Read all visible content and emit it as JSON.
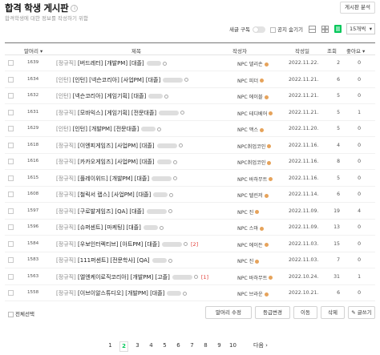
{
  "page": {
    "title": "합격 학생 게시판",
    "badge": "i",
    "subtitle": "합격학생에 대한 정보를 작성하기 위함",
    "analyze_button": "게시판 분석"
  },
  "toolbar": {
    "subscribe_label": "새글 구독",
    "hide_notice_label": "공지 숨기기",
    "per_page": "15개씩",
    "views": [
      "card-view-icon",
      "album-view-icon",
      "list-view-icon"
    ],
    "active_view": "list-view-icon",
    "accent_color": "#03c75a"
  },
  "table": {
    "headers": {
      "prefix": "말머리 ▾",
      "subject": "제목",
      "author": "작성자",
      "date": "작성일",
      "views": "조회",
      "likes": "좋아요 ▾"
    },
    "rows": [
      {
        "num": "1639",
        "head": "[정규직]",
        "title": "[버드레터] [개발PM] [대졸]",
        "author": "NPC 델리손",
        "date": "2022.11.22.",
        "views": "2",
        "likes": "0",
        "count": ""
      },
      {
        "num": "1634",
        "head": "[인턴]",
        "title": "[인턴] [넥슨코리아] [사업PM] [대졸]",
        "author": "NPC 피더",
        "date": "2022.11.21.",
        "views": "6",
        "likes": "0",
        "count": ""
      },
      {
        "num": "1632",
        "head": "[인턴]",
        "title": "[넥슨코리아] [게임기획] [대졸]",
        "author": "NPC 에이블",
        "date": "2022.11.21.",
        "views": "5",
        "likes": "0",
        "count": ""
      },
      {
        "num": "1631",
        "head": "[정규직]",
        "title": "[모바익스] [게임기획] [전문대졸]",
        "author": "NPC 테디베어",
        "date": "2022.11.21.",
        "views": "5",
        "likes": "1",
        "count": ""
      },
      {
        "num": "1629",
        "head": "[인턴]",
        "title": "[인턴] [개발PM] [전문대졸]",
        "author": "NPC 맥스",
        "date": "2022.11.20.",
        "views": "5",
        "likes": "0",
        "count": ""
      },
      {
        "num": "1618",
        "head": "[정규직]",
        "title": "[이엔피게임즈] [사업PM] [대졸]",
        "author": "NPC취업코인",
        "date": "2022.11.16.",
        "views": "4",
        "likes": "0",
        "count": ""
      },
      {
        "num": "1616",
        "head": "[정규직]",
        "title": "[카카오게임즈] [사업PM] [대졸]",
        "author": "NPC취업코인",
        "date": "2022.11.16.",
        "views": "8",
        "likes": "0",
        "count": ""
      },
      {
        "num": "1615",
        "head": "[정규직]",
        "title": "[플레이위드] [개발PM] [대졸]",
        "author": "NPC 바하무트",
        "date": "2022.11.16.",
        "views": "5",
        "likes": "0",
        "count": ""
      },
      {
        "num": "1608",
        "head": "[정규직]",
        "title": "[철릭서 랩스] [사업PM] [대졸]",
        "author": "NPC 텔린저",
        "date": "2022.11.14.",
        "views": "6",
        "likes": "0",
        "count": ""
      },
      {
        "num": "1597",
        "head": "[정규직]",
        "title": "[구로발게임즈] [QA] [대졸]",
        "author": "NPC 진",
        "date": "2022.11.09.",
        "views": "19",
        "likes": "4",
        "count": ""
      },
      {
        "num": "1596",
        "head": "[정규직]",
        "title": "[슈퍼센트] [마케팅] [대졸]",
        "author": "NPC 스마",
        "date": "2022.11.09.",
        "views": "13",
        "likes": "0",
        "count": ""
      },
      {
        "num": "1584",
        "head": "[정규직]",
        "title": "[우보인터렉티브] [아트PM] [대졸]",
        "author": "NPC 에이든",
        "date": "2022.11.03.",
        "views": "15",
        "likes": "0",
        "count": "[2]"
      },
      {
        "num": "1583",
        "head": "[정규직]",
        "title": "[111퍼센트] [전문학사] [QA]",
        "author": "NPC 진",
        "date": "2022.11.03.",
        "views": "7",
        "likes": "0",
        "count": ""
      },
      {
        "num": "1563",
        "head": "[정규직]",
        "title": "[엘엔케이로직코리아] [개발PM] [고졸]",
        "author": "NPC 바하무트",
        "date": "2022.10.24.",
        "views": "31",
        "likes": "1",
        "count": "[1]"
      },
      {
        "num": "1558",
        "head": "[정규직]",
        "title": "[이브이알스튜디오] [개발PM] [대졸]",
        "author": "NPC 브라운",
        "date": "2022.10.21.",
        "views": "6",
        "likes": "0",
        "count": ""
      }
    ]
  },
  "bottom": {
    "select_all": "전체선택",
    "buttons": [
      "말머리 수정",
      "등급변경",
      "이동",
      "삭제",
      "✎ 글쓰기"
    ]
  },
  "pagination": {
    "pages": [
      "1",
      "2",
      "3",
      "4",
      "5",
      "6",
      "7",
      "8",
      "9",
      "10"
    ],
    "current": "2",
    "next": "다음 ›"
  }
}
